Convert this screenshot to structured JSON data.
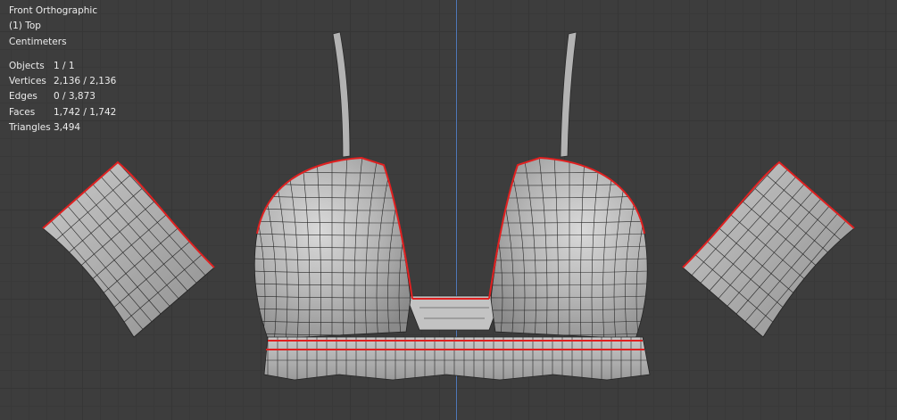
{
  "viewport": {
    "view_name": "Front Orthographic",
    "collection_object": "(1) Top",
    "units": "Centimeters"
  },
  "statistics": [
    {
      "label": "Objects",
      "value": "1 / 1"
    },
    {
      "label": "Vertices",
      "value": "2,136 / 2,136"
    },
    {
      "label": "Edges",
      "value": "0 / 3,873"
    },
    {
      "label": "Faces",
      "value": "1,742 / 1,742"
    },
    {
      "label": "Triangles",
      "value": "3,494"
    }
  ],
  "colors": {
    "background": "#3d3d3d",
    "mesh": "#b9b9b9",
    "wire": "#202020",
    "seam": "#e02020",
    "axis": "#4f78b8"
  }
}
